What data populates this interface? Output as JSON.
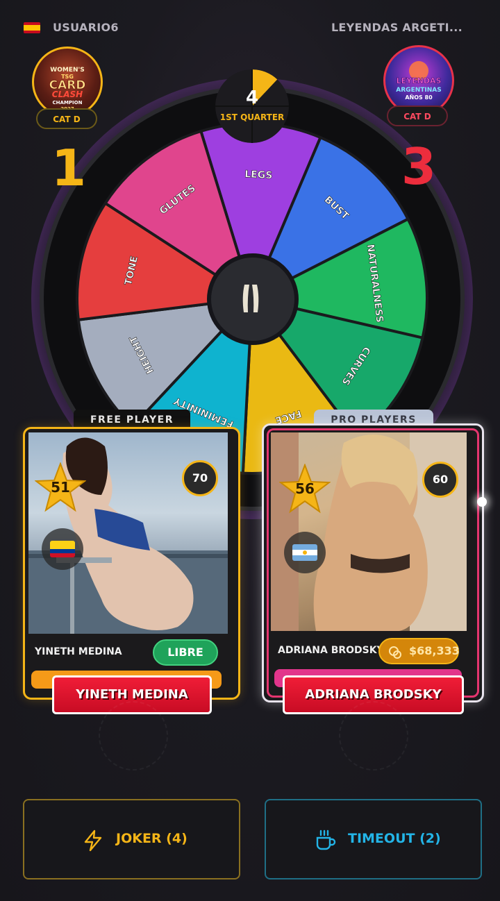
{
  "header": {
    "user_name": "USUARIO6",
    "opponent_name": "LEYENDAS ARGETI..."
  },
  "left_player": {
    "badge_text": [
      "WOMEN'S",
      "TSG",
      "CARD",
      "CLASH",
      "CHAMPION",
      "2027"
    ],
    "category": "CAT D",
    "score": "1"
  },
  "right_player": {
    "badge_text": [
      "LEYENDAS",
      "ARGENTINAS",
      "AÑOS 80"
    ],
    "category": "CAT D",
    "score": "3"
  },
  "wheel": {
    "segments": [
      {
        "label": "LEGS",
        "color": "#9e3fe0"
      },
      {
        "label": "BUST",
        "color": "#3a72e6"
      },
      {
        "label": "NATURALNESS",
        "color": "#1fb860"
      },
      {
        "label": "CURVES",
        "color": "#17a86a"
      },
      {
        "label": "FACE",
        "color": "#eab913"
      },
      {
        "label": "FEMININITY",
        "color": "#0fb3cf"
      },
      {
        "label": "HEIGHT",
        "color": "#a4adbe"
      },
      {
        "label": "TONE",
        "color": "#e53e3e"
      },
      {
        "label": "GLUTES",
        "color": "#e0458d"
      }
    ]
  },
  "timer": {
    "value": "4",
    "label": "1ST QUARTER",
    "progress": 0.12
  },
  "cards": {
    "left": {
      "tab": "FREE PLAYER",
      "star_rating": "51",
      "circle_rating": "70",
      "name": "YINETH MEDINA",
      "status": "LIBRE",
      "button_label": "YINETH MEDINA"
    },
    "right": {
      "tab": "PRO PLAYERS",
      "star_rating": "56",
      "circle_rating": "60",
      "name": "ADRIANA BRODSKY",
      "price": "$68,333",
      "button_label": "ADRIANA BRODSKY"
    }
  },
  "actions": {
    "joker": {
      "label": "JOKER (4)",
      "icon": "lightning-icon",
      "color": "#f5b517"
    },
    "timeout": {
      "label": "TIMEOUT (2)",
      "icon": "coffee-cup-icon",
      "color": "#23b5e8"
    }
  }
}
